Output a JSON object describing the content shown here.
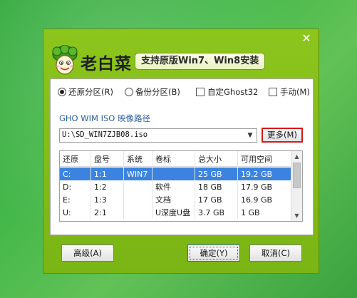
{
  "window": {
    "close_glyph": "✕"
  },
  "branding": {
    "title": "老白菜",
    "slogan": "支持原版Win7、Win8安装",
    "logo_icon": "cabbage-mascot-icon"
  },
  "options": [
    {
      "label": "还原分区(R)",
      "type": "radio",
      "checked": true
    },
    {
      "label": "备份分区(B)",
      "type": "radio",
      "checked": false
    },
    {
      "label": "自定Ghost32",
      "type": "checkbox",
      "checked": false
    },
    {
      "label": "手动(M)",
      "type": "checkbox",
      "checked": false
    }
  ],
  "path": {
    "label": "GHO WIM ISO 映像路径",
    "value": "U:\\SD_WIN7ZJB08.iso",
    "more_button": "更多(M)"
  },
  "partition_table": {
    "columns": [
      "还原",
      "盘号",
      "系统",
      "卷标",
      "总大小",
      "可用空间"
    ],
    "rows": [
      [
        "C:",
        "1:1",
        "WIN7",
        "",
        "25 GB",
        "19.2 GB"
      ],
      [
        "D:",
        "1:2",
        "",
        "软件",
        "18 GB",
        "17.9 GB"
      ],
      [
        "E:",
        "1:3",
        "",
        "文档",
        "17 GB",
        "16.9 GB"
      ],
      [
        "U:",
        "2:1",
        "",
        "U深度U盘",
        "3.7 GB",
        "1 GB"
      ]
    ],
    "selected_row": 0
  },
  "buttons": {
    "advanced": "高级(A)",
    "ok": "确定(Y)",
    "cancel": "取消(C)"
  },
  "colors": {
    "window_green": "#8cc51c",
    "selection_blue": "#3c83e0",
    "highlight_red": "#d41a1a",
    "label_blue": "#2b5f9e"
  }
}
